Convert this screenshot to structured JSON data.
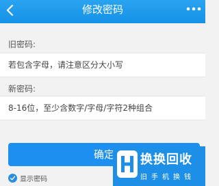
{
  "header": {
    "title": "修改密码",
    "back_icon": "chevron-left-icon",
    "more_icon": "more-dots-icon"
  },
  "form": {
    "old_password_label": "旧密码:",
    "old_password_placeholder": "若包含字母，请注意区分大小写",
    "new_password_label": "新密码:",
    "new_password_placeholder": "8-16位，至少含数字/字母/字符2种组合"
  },
  "actions": {
    "confirm_label": "确定",
    "show_password_label": "显示密码",
    "show_password_checked": true
  },
  "watermark": {
    "title": "换换回收",
    "subtitle": "旧手机换钱"
  },
  "colors": {
    "accent": "#1d8ff0",
    "header": "#1592e6",
    "background": "#f2f2f2"
  }
}
